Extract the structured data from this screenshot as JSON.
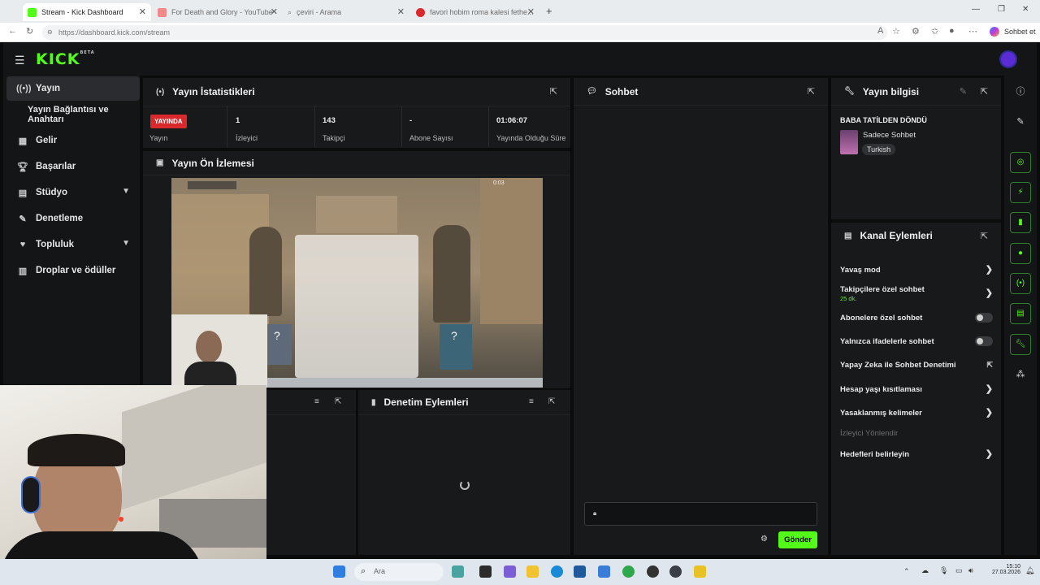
{
  "browser": {
    "tabs": [
      {
        "title": "Stream - Kick Dashboard",
        "active": true,
        "favicon_color": "#53fc18"
      },
      {
        "title": "For Death and Glory - YouTube",
        "active": false,
        "favicon_color": "#ff0000"
      },
      {
        "title": "çeviri - Arama",
        "active": false,
        "favicon_color": "#9aa0a6"
      },
      {
        "title": "favori hobim roma kalesi fethe...",
        "active": false,
        "favicon_color": "#d9292c"
      }
    ],
    "url": "https://dashboard.kick.com/stream",
    "profile_label": "Sohbet et"
  },
  "header": {
    "logo": "KICK",
    "logo_badge": "BETA"
  },
  "sidebar": {
    "items": [
      {
        "label": "Yayın",
        "icon": "broadcast-icon",
        "active": true
      },
      {
        "label": "Yayın Bağlantısı ve Anahtarı",
        "icon": "",
        "active": false
      },
      {
        "label": "Gelir",
        "icon": "revenue-icon",
        "active": false
      },
      {
        "label": "Başarılar",
        "icon": "trophy-icon",
        "active": false
      },
      {
        "label": "Stüdyo",
        "icon": "studio-icon",
        "active": false,
        "expandable": true
      },
      {
        "label": "Denetleme",
        "icon": "moderation-icon",
        "active": false
      },
      {
        "label": "Topluluk",
        "icon": "community-icon",
        "active": false,
        "expandable": true
      },
      {
        "label": "Droplar ve ödüller",
        "icon": "gift-icon",
        "active": false
      }
    ]
  },
  "stats_panel": {
    "title": "Yayın İstatistikleri",
    "live_badge": "YAYINDA",
    "stats": [
      {
        "label": "Yayın",
        "value": ""
      },
      {
        "label": "İzleyici",
        "value": "1"
      },
      {
        "label": "Takipçi",
        "value": "143"
      },
      {
        "label": "Abone Sayısı",
        "value": "-"
      },
      {
        "label": "Yayında Olduğu Süre",
        "value": "01:06:07"
      }
    ]
  },
  "preview_panel": {
    "title": "Yayın Ön İzlemesi",
    "timer": "0:03"
  },
  "moderation_panel": {
    "title": "Denetim Eylemleri"
  },
  "chat_panel": {
    "title": "Sohbet",
    "send_label": "Gönder"
  },
  "stream_info": {
    "title": "Yayın bilgisi",
    "stream_title": "BABA TATİLDEN DÖNDÜ",
    "category": "Sadece Sohbet",
    "language_tag": "Turkish"
  },
  "channel_actions": {
    "title": "Kanal Eylemleri",
    "items": [
      {
        "label": "Yavaş mod",
        "control": "chevron"
      },
      {
        "label": "Takipçilere özel sohbet",
        "sub": "25 dk.",
        "control": "chevron"
      },
      {
        "label": "Abonelere özel sohbet",
        "control": "toggle"
      },
      {
        "label": "Yalnızca ifadelerle sohbet",
        "control": "toggle"
      },
      {
        "label": "Yapay Zeka ile Sohbet Denetimi",
        "control": "external"
      },
      {
        "label": "Hesap yaşı kısıtlaması",
        "control": "chevron"
      },
      {
        "label": "Yasaklanmış kelimeler",
        "control": "chevron"
      },
      {
        "label": "İzleyici Yönlendir",
        "control": "disabled"
      },
      {
        "label": "Hedefleri belirleyin",
        "control": "chevron"
      }
    ]
  },
  "taskbar": {
    "search_placeholder": "Ara",
    "time": "15:10",
    "date": "27.03.2026"
  },
  "colors": {
    "accent": "#53fc18",
    "live": "#d9292c",
    "panel_bg": "#18191b",
    "page_bg": "#0b0b0c"
  }
}
